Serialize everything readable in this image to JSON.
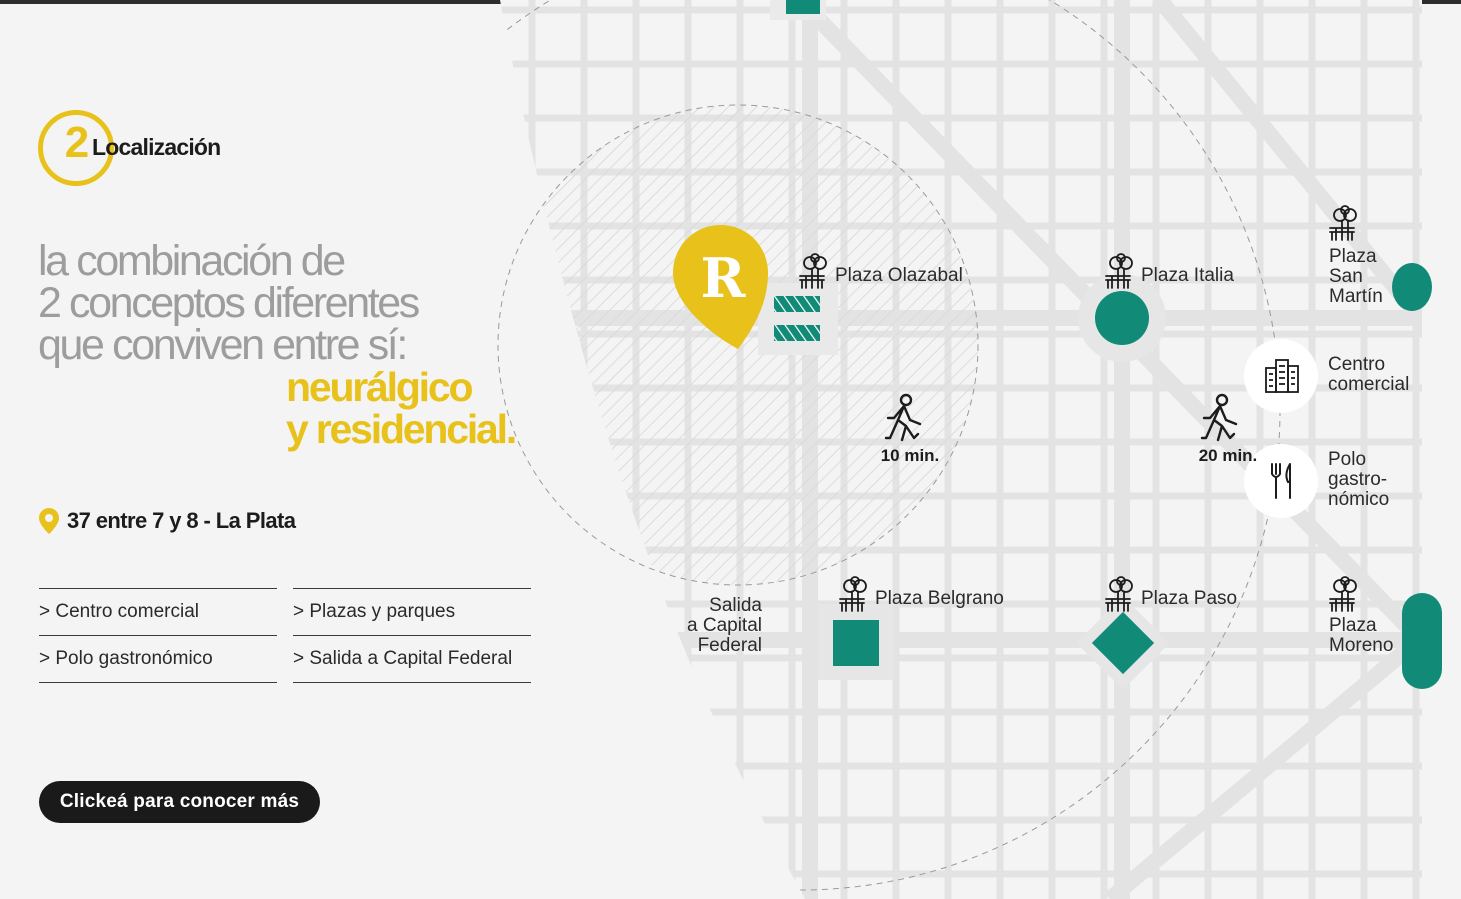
{
  "colors": {
    "accent": "#e8c21a",
    "teal": "#128a78",
    "dark": "#1a1a1a",
    "street": "#e4e4e4",
    "muted": "#9d9d9d"
  },
  "section": {
    "number": "2",
    "title": "Localización"
  },
  "headline": {
    "line1": "la combinación de",
    "line2": "2 conceptos diferentes",
    "line3": "que conviven entre sí:",
    "accent1": "neurálgico",
    "accent2": "y residencial."
  },
  "address": {
    "icon": "location-pin-icon",
    "text": "37 entre 7 y 8 - La Plata"
  },
  "links": [
    {
      "label": "> Centro comercial"
    },
    {
      "label": "> Plazas y parques"
    },
    {
      "label": "> Polo gastronómico"
    },
    {
      "label": "> Salida a Capital Federal"
    }
  ],
  "cta": {
    "label": "Clickeá para conocer más"
  },
  "map": {
    "marker_letter": "R",
    "walk_10": "10 min.",
    "walk_20": "20 min.",
    "places": {
      "olazabal": "Plaza Olazabal",
      "italia": "Plaza Italia",
      "san_martin": "Plaza\nSan\nMartín",
      "belgrano": "Plaza Belgrano",
      "paso": "Plaza Paso",
      "moreno": "Plaza\nMoreno",
      "centro": "Centro\ncomercial",
      "polo": "Polo\ngastro-\nnómico",
      "salida": "Salida\na Capital\nFederal"
    }
  }
}
